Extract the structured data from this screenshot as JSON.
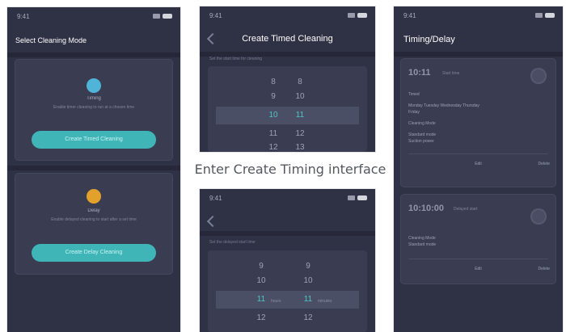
{
  "status": {
    "time": "9:41"
  },
  "panel1": {
    "title": "Select Cleaning Mode",
    "timing": {
      "name": "Timing",
      "desc": "Enable timer cleaning to run at a chosen time",
      "button": "Create Timed Cleaning"
    },
    "delay": {
      "name": "Delay",
      "desc": "Enable delayed cleaning to start after a set time",
      "button": "Create Delay Cleaning"
    }
  },
  "panel2": {
    "title": "Create Timed Cleaning",
    "hint": "Set the start time for cleaning",
    "hours": [
      "8",
      "9",
      "10",
      "11",
      "12"
    ],
    "minutes": [
      "8",
      "10",
      "11",
      "12",
      "13"
    ]
  },
  "caption": "Enter Create Timing interface",
  "panel4": {
    "hint": "Set the delayed start time",
    "hours": [
      "9",
      "10",
      "11",
      "12"
    ],
    "minutes": [
      "9",
      "10",
      "11",
      "12"
    ],
    "hour_unit": "hours",
    "minute_unit": "minutes"
  },
  "panel3": {
    "title": "Timing/Delay",
    "card1": {
      "time": "10:11",
      "sub": "Start time",
      "line1": "Timed",
      "line2": "Monday Tuesday Wednesday Thursday",
      "line3": "Friday",
      "line4": "Cleaning Mode",
      "line5": "Standard mode",
      "line6": "Suction power",
      "button": "Edit",
      "delete": "Delete"
    },
    "card2": {
      "time": "10:10:00",
      "sub": "Delayed start",
      "line1": "Cleaning Mode",
      "line2": "Standard mode",
      "button": "Edit",
      "delete": "Delete"
    }
  }
}
